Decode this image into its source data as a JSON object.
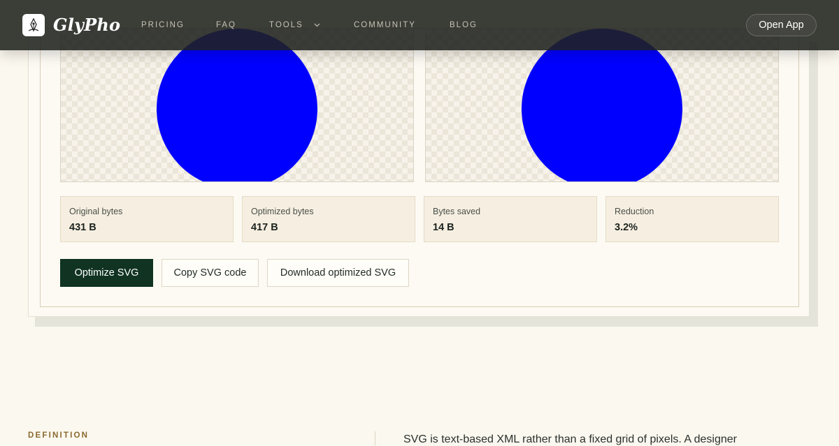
{
  "header": {
    "brand": "GlyPho",
    "nav": [
      {
        "label": "PRICING"
      },
      {
        "label": "FAQ"
      },
      {
        "label": "TOOLS",
        "has_dropdown": true
      },
      {
        "label": "COMMUNITY"
      },
      {
        "label": "BLOG"
      }
    ],
    "open_app_label": "Open App"
  },
  "previews": {
    "shape_color": "#0000ff"
  },
  "stats": [
    {
      "label": "Original bytes",
      "value": "431 B"
    },
    {
      "label": "Optimized bytes",
      "value": "417 B"
    },
    {
      "label": "Bytes saved",
      "value": "14 B"
    },
    {
      "label": "Reduction",
      "value": "3.2%"
    }
  ],
  "actions": {
    "optimize_label": "Optimize SVG",
    "copy_label": "Copy SVG code",
    "download_label": "Download optimized SVG"
  },
  "definition": {
    "label": "DEFINITION",
    "text": "SVG is text-based XML rather than a fixed grid of pixels. A designer"
  },
  "colors": {
    "header_bg": "#20221e",
    "primary_button": "#103322",
    "accent_label": "#8a6a30",
    "page_bg": "#fbf8ef"
  }
}
